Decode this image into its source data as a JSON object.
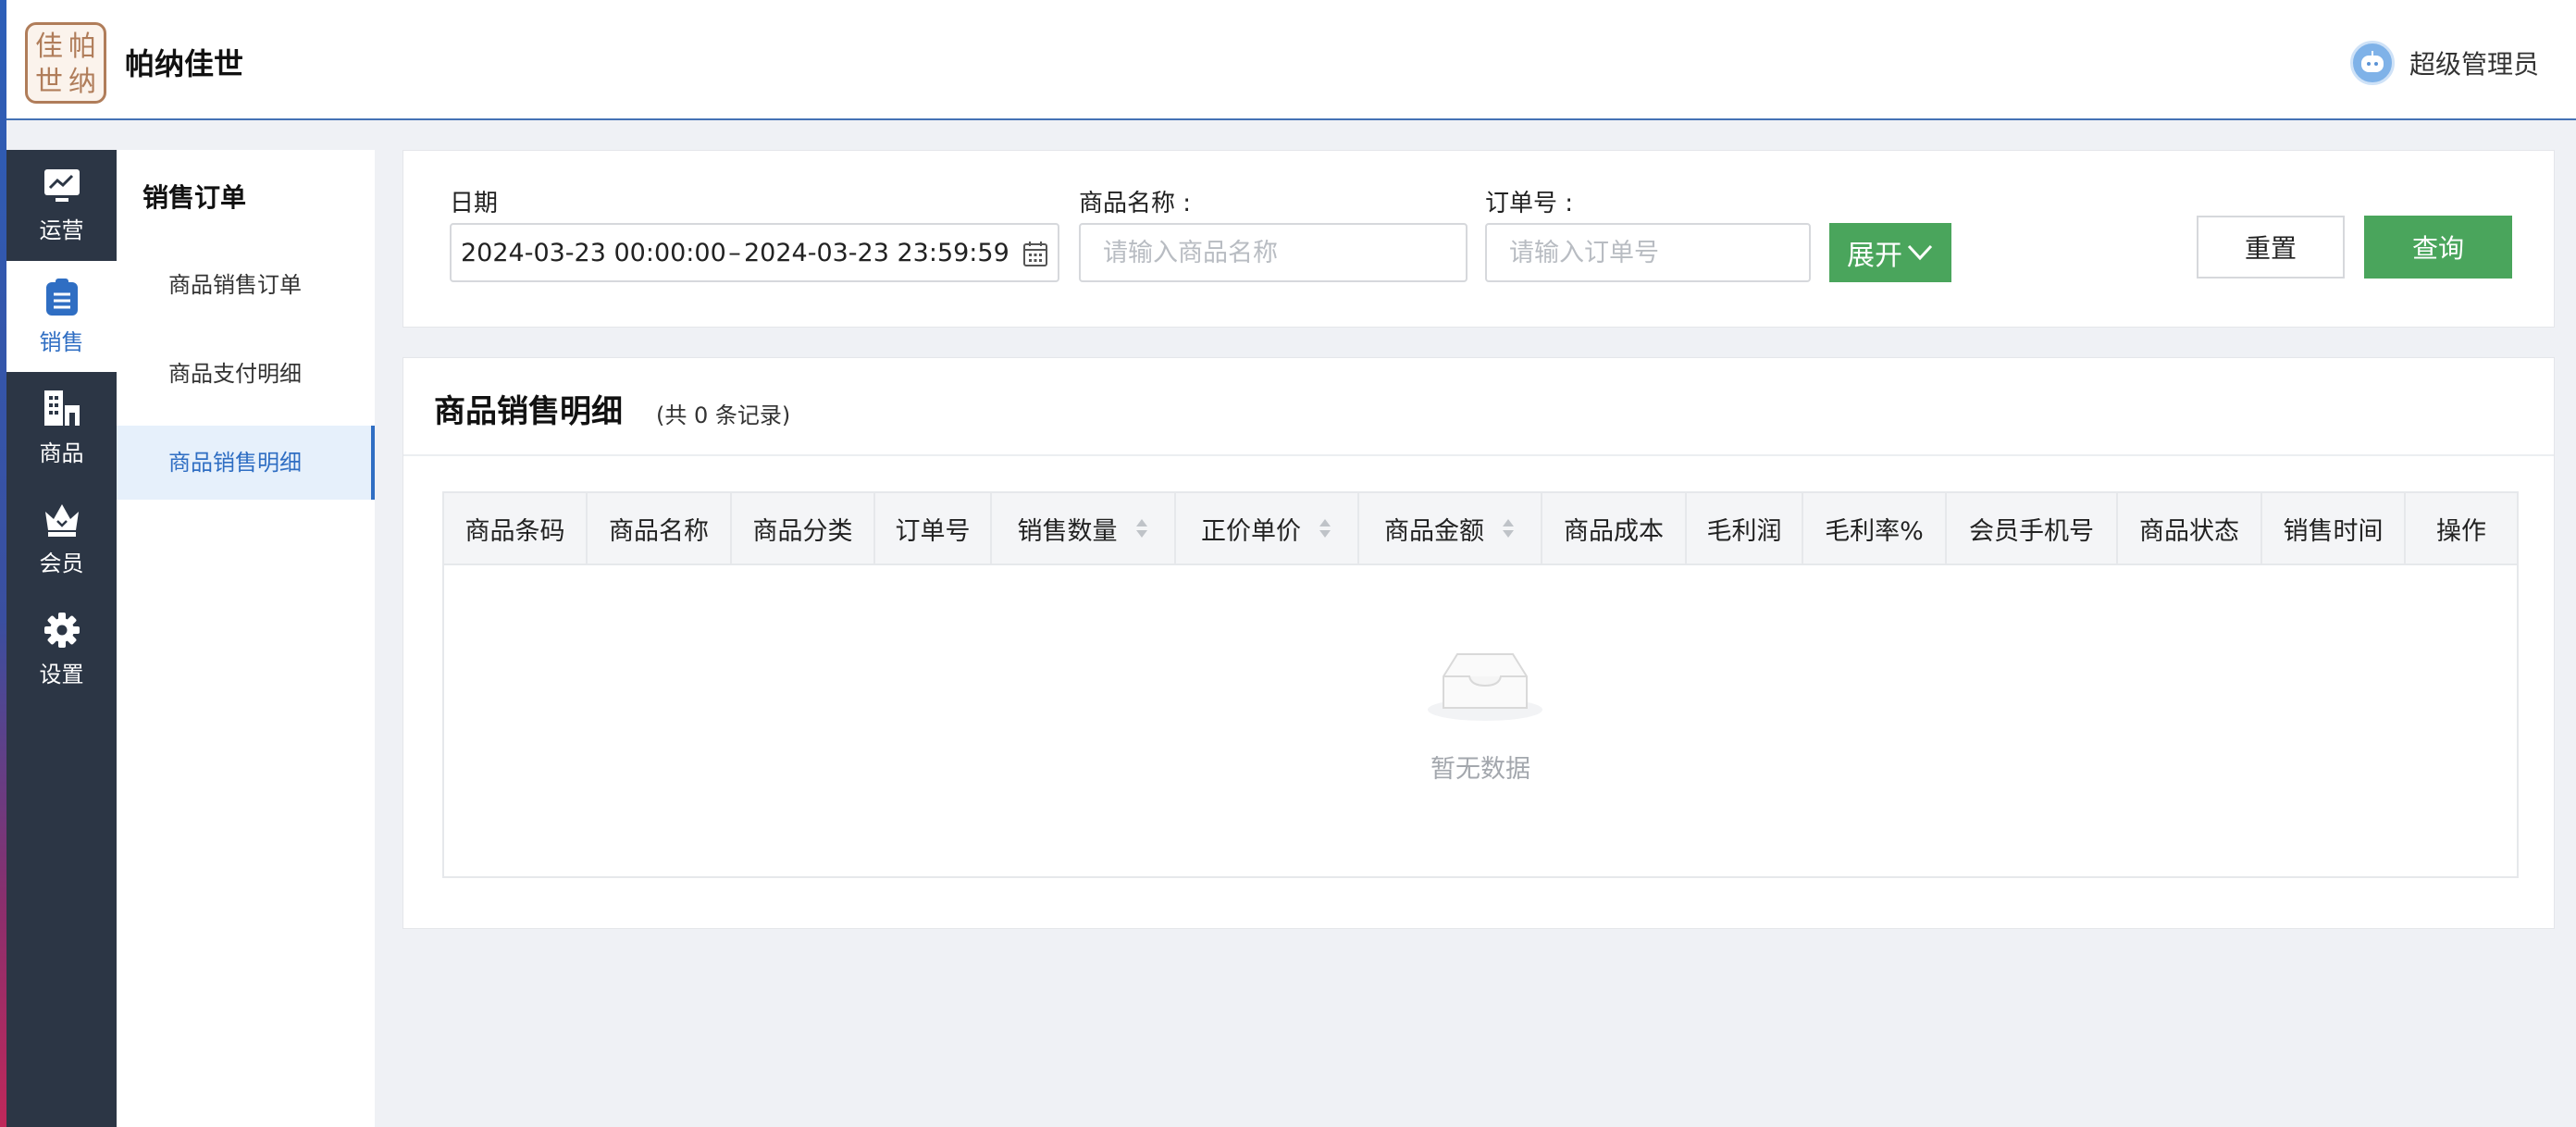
{
  "header": {
    "logo_chars": [
      "佳",
      "帕",
      "世",
      "纳"
    ],
    "brand": "帕纳佳世",
    "user_name": "超级管理员"
  },
  "rail": [
    {
      "label": "运营",
      "icon": "monitor-icon",
      "active": false
    },
    {
      "label": "销售",
      "icon": "clipboard-icon",
      "active": true
    },
    {
      "label": "商品",
      "icon": "building-icon",
      "active": false
    },
    {
      "label": "会员",
      "icon": "crown-icon",
      "active": false
    },
    {
      "label": "设置",
      "icon": "gear-icon",
      "active": false
    }
  ],
  "submenu": {
    "title": "销售订单",
    "items": [
      {
        "label": "商品销售订单",
        "active": false
      },
      {
        "label": "商品支付明细",
        "active": false
      },
      {
        "label": "商品销售明细",
        "active": true
      }
    ]
  },
  "filters": {
    "date_label": "日期",
    "date_start": "2024-03-23 00:00:00",
    "date_sep": "–",
    "date_end": "2024-03-23 23:59:59",
    "product_label": "商品名称 :",
    "product_placeholder": "请输入商品名称",
    "order_label": "订单号 :",
    "order_placeholder": "请输入订单号",
    "expand_label": "展开",
    "reset_label": "重置",
    "query_label": "查询"
  },
  "result": {
    "title": "商品销售明细",
    "count_text": "(共 0 条记录)",
    "columns": [
      {
        "label": "商品条码",
        "sortable": false
      },
      {
        "label": "商品名称",
        "sortable": false
      },
      {
        "label": "商品分类",
        "sortable": false
      },
      {
        "label": "订单号",
        "sortable": false
      },
      {
        "label": "销售数量",
        "sortable": true
      },
      {
        "label": "正价单价",
        "sortable": true
      },
      {
        "label": "商品金额",
        "sortable": true
      },
      {
        "label": "商品成本",
        "sortable": false
      },
      {
        "label": "毛利润",
        "sortable": false
      },
      {
        "label": "毛利率%",
        "sortable": false
      },
      {
        "label": "会员手机号",
        "sortable": false
      },
      {
        "label": "商品状态",
        "sortable": false
      },
      {
        "label": "销售时间",
        "sortable": false
      },
      {
        "label": "操作",
        "sortable": false
      }
    ],
    "empty_text": "暂无数据"
  },
  "colors": {
    "accent": "#2f6ec3",
    "primary_button": "#4aa55c",
    "rail_bg": "#2c3645"
  }
}
